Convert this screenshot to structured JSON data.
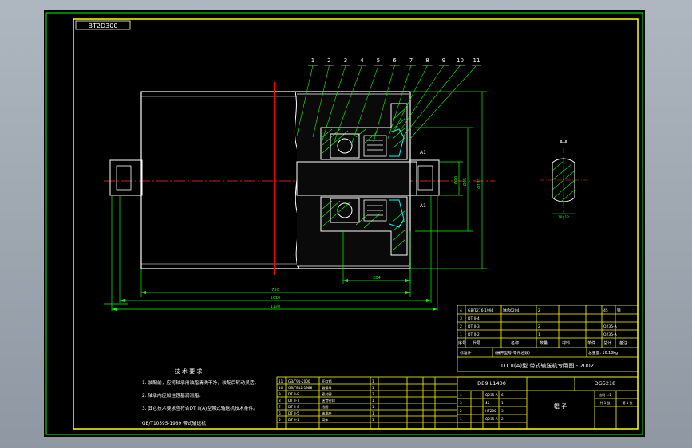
{
  "drawing": {
    "stamp": "BT2D300",
    "part_numbers": [
      "1",
      "2",
      "3",
      "4",
      "5",
      "6",
      "7",
      "8",
      "9",
      "10",
      "11"
    ],
    "section_mark": "A-A",
    "cut_labels": [
      "A1",
      "A1"
    ],
    "dim_vert": [
      "Ø133",
      "Ø45",
      "Ø20"
    ],
    "dim_horiz": [
      "750",
      "1010",
      "1170"
    ],
    "dim_small": "284",
    "dim_key": "18h12"
  },
  "notes": {
    "title": "技 术 要 求",
    "lines": [
      "1. 装配前，应将轴承用油脂清洗干净，装配后转动灵活。",
      "2. 轴承内应加注锂基润滑脂。",
      "3. 其它技术要求应符合DT II(A)型带式输送机技术条件。",
      "GB/T10595-1989 带式输送机"
    ]
  },
  "upper_table": {
    "rows": [
      [
        "4",
        "GB/T276-1994",
        "1",
        "轴承6204",
        "",
        "2",
        "",
        "45",
        "钢"
      ],
      [
        "3",
        "DT II-4",
        "1",
        "",
        "",
        "",
        "",
        "",
        ""
      ],
      [
        "2",
        "DT II-3",
        "1",
        "",
        "",
        "2",
        "",
        "Q235-A",
        ""
      ],
      [
        "1",
        "DT II-2",
        "1",
        "",
        "",
        "1",
        "",
        "Q235-A",
        ""
      ]
    ],
    "header": [
      "序号",
      "代号",
      "名称",
      "数量",
      "材料",
      "单件",
      "总计",
      "备注"
    ],
    "footer": [
      "标准件",
      "(展开型号-零件总数)",
      "总重量: 16.18kg"
    ],
    "title": "DT II(A)型 带式输送机专用图 - 2002"
  },
  "lower_table": {
    "rows": [
      [
        "11",
        "GB/T91-2000",
        "开口销",
        "1"
      ],
      [
        "10",
        "GB/T812-1988",
        "圆螺母",
        "1"
      ],
      [
        "9",
        "DT II-8",
        "密封圈",
        "2"
      ],
      [
        "8",
        "DT II-7",
        "迷宫密封",
        "1"
      ],
      [
        "7",
        "DT II-6",
        "挡圈",
        "1"
      ],
      [
        "6",
        "DT II-5",
        "轴承座",
        "1"
      ],
      [
        "5",
        "DT II-1",
        "筒体",
        "1"
      ]
    ],
    "right_rows": [
      [
        "4",
        "Q235-A",
        "6"
      ],
      [
        "3",
        "45",
        "1"
      ],
      [
        "2",
        "HT200",
        "3"
      ],
      [
        "1",
        "Q235-A",
        "2"
      ]
    ],
    "part_code": "DB9 L1400",
    "drawing_no": "DG5218",
    "part_name": "辊 子",
    "info": [
      "比例 1:1",
      "共 1 张",
      "第 1 张"
    ]
  },
  "colors": {
    "bg": "#000000",
    "border": "#ffff00",
    "green": "#00ff00",
    "yellow": "#ffff00",
    "red": "#ff0000",
    "white": "#ffffff",
    "cyan": "#00ffff",
    "magenta": "#ff00ff"
  }
}
